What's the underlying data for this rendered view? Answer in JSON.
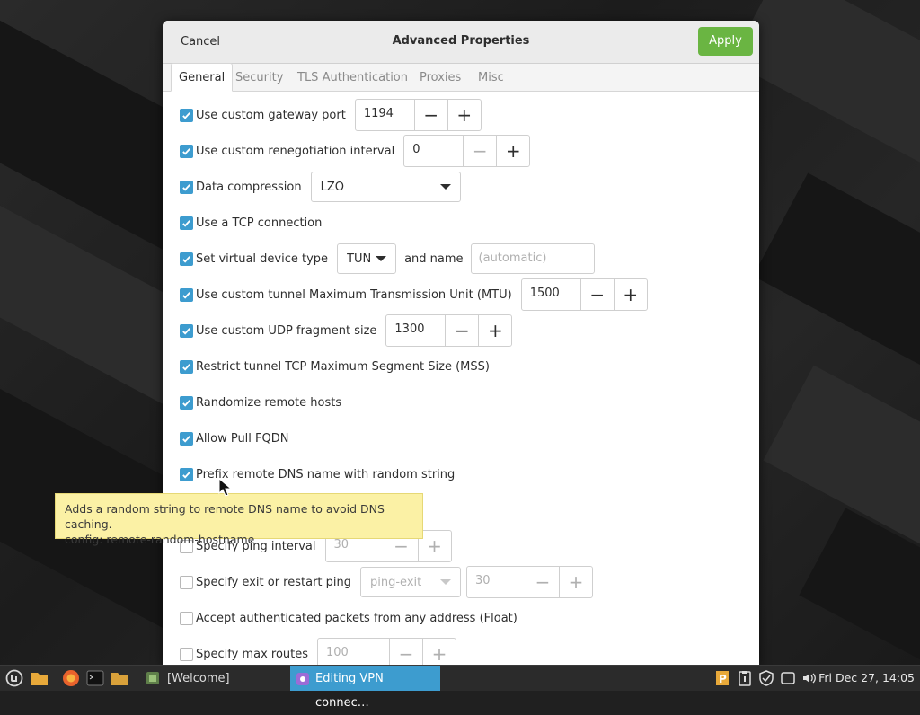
{
  "dialog": {
    "title": "Advanced Properties",
    "cancel_label": "Cancel",
    "apply_label": "Apply",
    "accent_color": "#6ab542"
  },
  "tabs": [
    {
      "label": "General",
      "active": true
    },
    {
      "label": "Security",
      "active": false
    },
    {
      "label": "TLS Authentication",
      "active": false
    },
    {
      "label": "Proxies",
      "active": false
    },
    {
      "label": "Misc",
      "active": false
    }
  ],
  "options": {
    "gateway_port": {
      "label": "Use custom gateway port",
      "checked": true,
      "value": "1194"
    },
    "renegotiation": {
      "label": "Use custom renegotiation interval",
      "checked": true,
      "value": "0"
    },
    "compression": {
      "label": "Data compression",
      "checked": true,
      "value": "LZO"
    },
    "tcp": {
      "label": "Use a TCP connection",
      "checked": true
    },
    "device_type": {
      "label": "Set virtual device type",
      "checked": true,
      "value": "TUN",
      "name_label": "and name",
      "name_placeholder": "(automatic)"
    },
    "mtu": {
      "label": "Use custom tunnel Maximum Transmission Unit (MTU)",
      "checked": true,
      "value": "1500"
    },
    "udp_fragment": {
      "label": "Use custom UDP fragment size",
      "checked": true,
      "value": "1300"
    },
    "mss": {
      "label": "Restrict tunnel TCP Maximum Segment Size (MSS)",
      "checked": true
    },
    "randomize_hosts": {
      "label": "Randomize remote hosts",
      "checked": true
    },
    "pull_fqdn": {
      "label": "Allow Pull FQDN",
      "checked": true
    },
    "prefix_dns": {
      "label": "Prefix remote DNS name with random string",
      "checked": true
    },
    "ping_interval": {
      "label": "Specify ping interval",
      "checked": false,
      "value": "30"
    },
    "exit_ping": {
      "label": "Specify exit or restart ping",
      "checked": false,
      "mode": "ping-exit",
      "value": "30"
    },
    "float": {
      "label": "Accept authenticated packets from any address (Float)",
      "checked": false
    },
    "max_routes": {
      "label": "Specify max routes",
      "checked": false,
      "value": "100"
    }
  },
  "tooltip": {
    "line1": "Adds a random string to remote DNS name to avoid DNS caching.",
    "line2": "config: remote-random-hostname"
  },
  "taskbar": {
    "tasks": [
      {
        "label": "[Welcome]",
        "active": false
      },
      {
        "label": "Editing VPN connec…",
        "active": true
      }
    ],
    "clock": "Fri Dec 27, 14:05",
    "active_color": "#3d9ccf"
  }
}
